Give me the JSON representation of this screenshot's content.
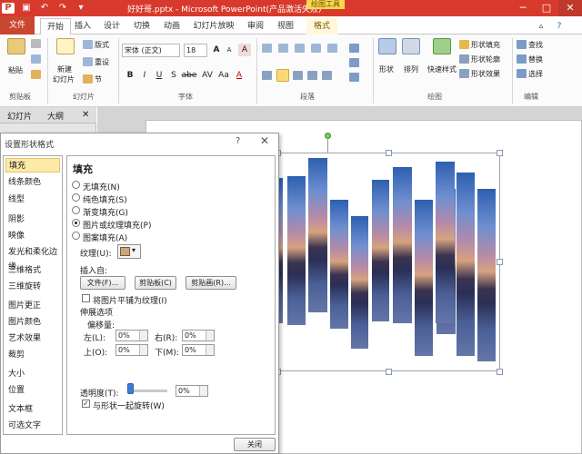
{
  "titlebar": {
    "doc_title": "好好哥.pptx - Microsoft PowerPoint(产品激活失败)",
    "context_tab_header": "绘图工具",
    "qat": {
      "save_icon": "save-icon",
      "undo_icon": "undo-icon",
      "redo_icon": "redo-icon"
    },
    "controls": {
      "minimize": "─",
      "maximize": "□",
      "close": "✕"
    }
  },
  "tabs": {
    "file": "文件",
    "items": [
      "开始",
      "插入",
      "设计",
      "切换",
      "动画",
      "幻灯片放映",
      "审阅",
      "视图",
      "格式"
    ],
    "active": "开始",
    "context": "格式"
  },
  "ribbon": {
    "clipboard": {
      "paste": "粘贴",
      "label": "剪贴板"
    },
    "slides": {
      "new_slide": "新建",
      "new_slide2": "幻灯片",
      "layout": "版式",
      "reset": "重设",
      "section": "节",
      "label": "幻灯片"
    },
    "font": {
      "name": "宋体 (正文)",
      "size": "18",
      "label": "字体",
      "bold": "B",
      "italic": "I",
      "underline": "U",
      "strike": "S",
      "shadow": "abe",
      "spacing": "AV",
      "case": "Aa",
      "grow": "A",
      "shrink": "A"
    },
    "paragraph": {
      "label": "段落"
    },
    "drawing": {
      "shape": "形状",
      "arrange": "排列",
      "quick_style": "快速样式",
      "fill": "形状填充",
      "outline": "形状轮廓",
      "effect": "形状效果",
      "label": "绘图"
    },
    "editing": {
      "find": "查找",
      "replace": "替换",
      "select": "选择",
      "label": "编辑"
    }
  },
  "pane": {
    "tab_slides": "幻灯片",
    "tab_outline": "大纲"
  },
  "dialog": {
    "title": "设置形状格式",
    "help": "?",
    "close": "✕",
    "nav": [
      "填充",
      "线条颜色",
      "线型",
      "阴影",
      "映像",
      "发光和柔化边缘",
      "三维格式",
      "三维旋转",
      "图片更正",
      "图片颜色",
      "艺术效果",
      "裁剪",
      "大小",
      "位置",
      "文本框",
      "可选文字"
    ],
    "nav_active": "填充",
    "content": {
      "heading": "填充",
      "options": [
        "无填充(N)",
        "纯色填充(S)",
        "渐变填充(G)",
        "图片或纹理填充(P)",
        "图案填充(A)"
      ],
      "selected_option": "图片或纹理填充(P)",
      "texture_label": "纹理(U):",
      "insert_from": "插入自:",
      "file_btn": "文件(F)...",
      "clipboard_btn": "剪贴板(C)",
      "clipart_btn": "剪贴画(R)...",
      "tile_label": "将图片平铺为纹理(I)",
      "tile_checked": false,
      "stretch_options": "伸展选项",
      "offsets": "偏移量:",
      "left_label": "左(L):",
      "left_val": "0%",
      "right_label": "右(R):",
      "right_val": "0%",
      "top_label": "上(O):",
      "top_val": "0%",
      "bottom_label": "下(M):",
      "bottom_val": "0%",
      "transparency_label": "透明度(T):",
      "transparency_val": "0%",
      "transparency_fraction": 0,
      "rotate_label": "与形状一起旋转(W)",
      "rotate_checked": true
    },
    "close_button": "关闭"
  },
  "colors": {
    "title_bar": "#d73a2c",
    "file_tab": "#c94630",
    "context_tab": "#f7d84f",
    "selected_nav": "#fde9a8"
  }
}
